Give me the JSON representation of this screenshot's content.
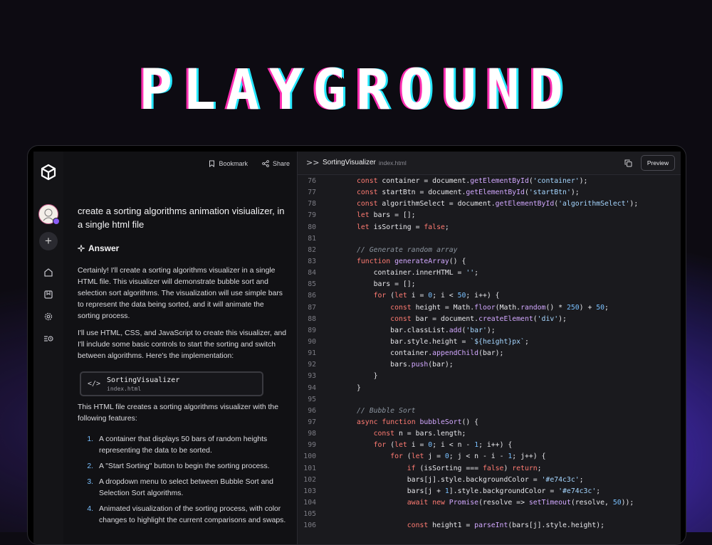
{
  "hero_title": "PLAYGROUND",
  "chat": {
    "bookmark_label": "Bookmark",
    "share_label": "Share",
    "prompt": "create a sorting algorithms animation visiualizer, in a single html file",
    "answer_label": "Answer",
    "paragraphs": [
      "Certainly! I'll create a sorting algorithms visualizer in a single HTML file. This visualizer will demonstrate bubble sort and selection sort algorithms. The visualization will use simple bars to represent the data being sorted, and it will animate the sorting process.",
      "I'll use HTML, CSS, and JavaScript to create this visualizer, and I'll include some basic controls to start the sorting and switch between algorithms. Here's the implementation:",
      "This HTML file creates a sorting algorithms visualizer with the following features:"
    ],
    "artifact": {
      "title": "SortingVisualizer",
      "file": "index.html"
    },
    "features": [
      {
        "num": "1.",
        "text": "A container that displays 50 bars of random heights representing the data to be sorted."
      },
      {
        "num": "2.",
        "text": "A \"Start Sorting\" button to begin the sorting process."
      },
      {
        "num": "3.",
        "text": "A dropdown menu to select between Bubble Sort and Selection Sort algorithms."
      },
      {
        "num": "4.",
        "text": "Animated visualization of the sorting process, with color changes to highlight the current comparisons and swaps."
      }
    ]
  },
  "editor": {
    "chevron": ">>",
    "file_title": "SortingVisualizer",
    "file_name": "index.html",
    "preview_label": "Preview",
    "line_numbers": [
      "76",
      "77",
      "78",
      "79",
      "80",
      "81",
      "82",
      "83",
      "84",
      "85",
      "86",
      "87",
      "88",
      "89",
      "90",
      "91",
      "92",
      "93",
      "94",
      "95",
      "96",
      "97",
      "98",
      "99",
      "100",
      "101",
      "102",
      "103",
      "104",
      "105",
      "106"
    ],
    "lines": [
      "const container = document.getElementById('container');",
      "const startBtn = document.getElementById('startBtn');",
      "const algorithmSelect = document.getElementById('algorithmSelect');",
      "let bars = [];",
      "let isSorting = false;",
      "",
      "// Generate random array",
      "function generateArray() {",
      "    container.innerHTML = '';",
      "    bars = [];",
      "    for (let i = 0; i < 50; i++) {",
      "        const height = Math.floor(Math.random() * 250) + 50;",
      "        const bar = document.createElement('div');",
      "        bar.classList.add('bar');",
      "        bar.style.height = `${height}px`;",
      "        container.appendChild(bar);",
      "        bars.push(bar);",
      "    }",
      "}",
      "",
      "// Bubble Sort",
      "async function bubbleSort() {",
      "    const n = bars.length;",
      "    for (let i = 0; i < n - 1; i++) {",
      "        for (let j = 0; j < n - i - 1; j++) {",
      "            if (isSorting === false) return;",
      "            bars[j].style.backgroundColor = '#e74c3c';",
      "            bars[j + 1].style.backgroundColor = '#e74c3c';",
      "            await new Promise(resolve => setTimeout(resolve, 50));",
      "",
      "            const height1 = parseInt(bars[j].style.height);"
    ]
  }
}
